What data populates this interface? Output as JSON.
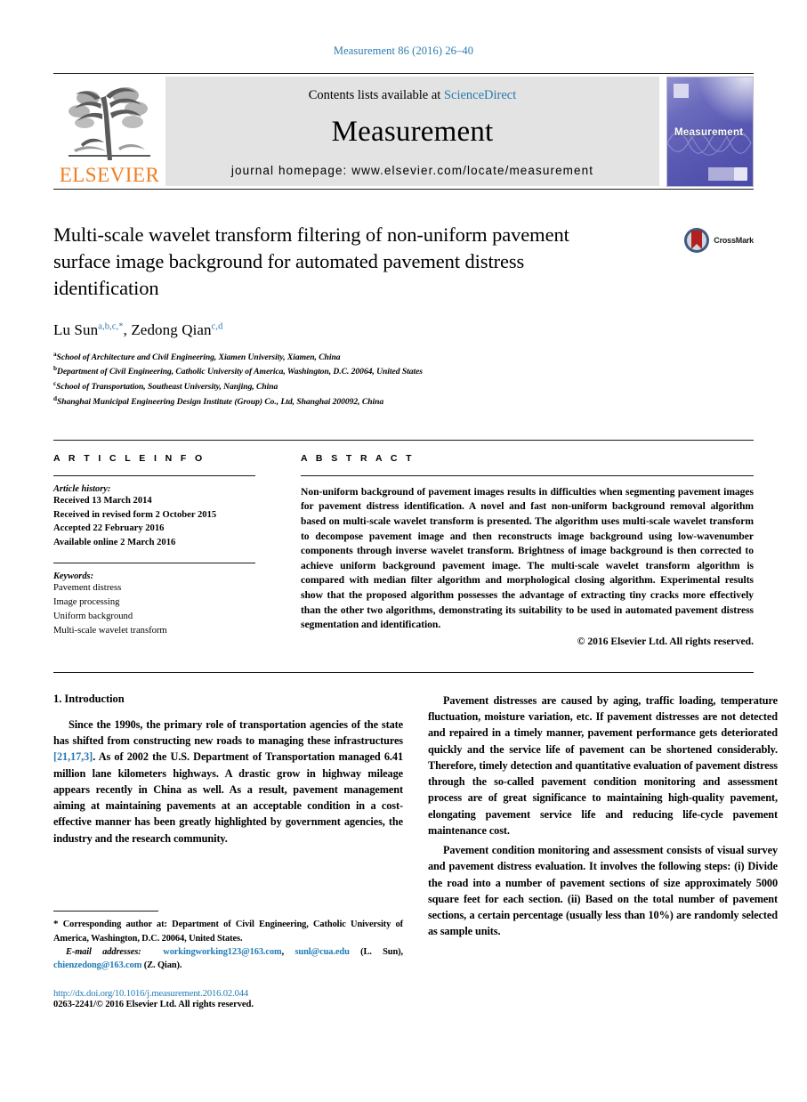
{
  "running_head": "Measurement 86 (2016) 26–40",
  "masthead": {
    "publisher_logo_text": "ELSEVIER",
    "contents_prefix": "Contents lists available at ",
    "contents_link": "ScienceDirect",
    "journal_name": "Measurement",
    "homepage": "journal homepage: www.elsevier.com/locate/measurement",
    "cover_title": "Measurement",
    "link_color": "#2a7ab0"
  },
  "article": {
    "title": "Multi-scale wavelet transform filtering of non-uniform pavement surface image background for automated pavement distress identification",
    "crossmark_label": "CrossMark",
    "authors_plain": "Lu Sun",
    "author1": "Lu Sun",
    "author1_sup": "a,b,c,*",
    "author2": "Zedong Qian",
    "author2_sup": "c,d",
    "affiliations": [
      {
        "marker": "a",
        "text": "School of Architecture and Civil Engineering, Xiamen University, Xiamen, China"
      },
      {
        "marker": "b",
        "text": "Department of Civil Engineering, Catholic University of America, Washington, D.C. 20064, United States"
      },
      {
        "marker": "c",
        "text": "School of Transportation, Southeast University, Nanjing, China"
      },
      {
        "marker": "d",
        "text": "Shanghai Municipal Engineering Design Institute (Group) Co., Ltd, Shanghai 200092, China"
      }
    ]
  },
  "article_info": {
    "heading": "A R T I C L E    I N F O",
    "history_label": "Article history:",
    "history": [
      "Received 13 March 2014",
      "Received in revised form 2 October 2015",
      "Accepted 22 February 2016",
      "Available online 2 March 2016"
    ],
    "keywords_label": "Keywords:",
    "keywords": [
      "Pavement distress",
      "Image processing",
      "Uniform background",
      "Multi-scale wavelet transform"
    ]
  },
  "abstract": {
    "heading": "A B S T R A C T",
    "text": "Non-uniform background of pavement images results in difficulties when segmenting pavement images for pavement distress identification. A novel and fast non-uniform background removal algorithm based on multi-scale wavelet transform is presented. The algorithm uses multi-scale wavelet transform to decompose pavement image and then reconstructs image background using low-wavenumber components through inverse wavelet transform. Brightness of image background is then corrected to achieve uniform background pavement image. The multi-scale wavelet transform algorithm is compared with median filter algorithm and morphological closing algorithm. Experimental results show that the proposed algorithm possesses the advantage of extracting tiny cracks more effectively than the other two algorithms, demonstrating its suitability to be used in automated pavement distress segmentation and identification.",
    "copyright": "© 2016 Elsevier Ltd. All rights reserved."
  },
  "body": {
    "section_heading": "1. Introduction",
    "left_para_1_a": "Since the 1990s, the primary role of transportation agencies of the state has shifted from constructing new roads to managing these infrastructures ",
    "left_para_1_ref": "[21,17,3]",
    "left_para_1_b": ". As of 2002 the U.S. Department of Transportation managed 6.41 million lane kilometers highways. A drastic grow in highway mileage appears recently in China as well. As a result, pavement management aiming at maintaining pavements at an acceptable condition in a cost-effective manner has been greatly highlighted by government agencies, the industry and the research community.",
    "right_para_1": "Pavement distresses are caused by aging, traffic loading, temperature fluctuation, moisture variation, etc. If pavement distresses are not detected and repaired in a timely manner, pavement performance gets deteriorated quickly and the service life of pavement can be shortened considerably. Therefore, timely detection and quantitative evaluation of pavement distress through the so-called pavement condition monitoring and assessment process are of great significance to maintaining high-quality pavement, elongating pavement service life and reducing life-cycle pavement maintenance cost.",
    "right_para_2": "Pavement condition monitoring and assessment consists of visual survey and pavement distress evaluation. It involves the following steps: (i) Divide the road into a number of pavement sections of size approximately 5000 square feet for each section. (ii) Based on the total number of pavement sections, a certain percentage (usually less than 10%) are randomly selected as sample units."
  },
  "footnotes": {
    "corresponding_star": "*",
    "corresponding_text": " Corresponding author at: Department of Civil Engineering, Catholic University of America, Washington, D.C. 20064, United States.",
    "email_label": "E-mail addresses:",
    "email_1": "workingworking123@163.com",
    "email_sep1": ", ",
    "email_2": "sunl@cua.edu",
    "email_owner_1": " (L. Sun), ",
    "email_3": "chienzedong@163.com",
    "email_owner_2": " (Z. Qian).",
    "doi": "http://dx.doi.org/10.1016/j.measurement.2016.02.044",
    "issn": "0263-2241/© 2016 Elsevier Ltd. All rights reserved."
  }
}
